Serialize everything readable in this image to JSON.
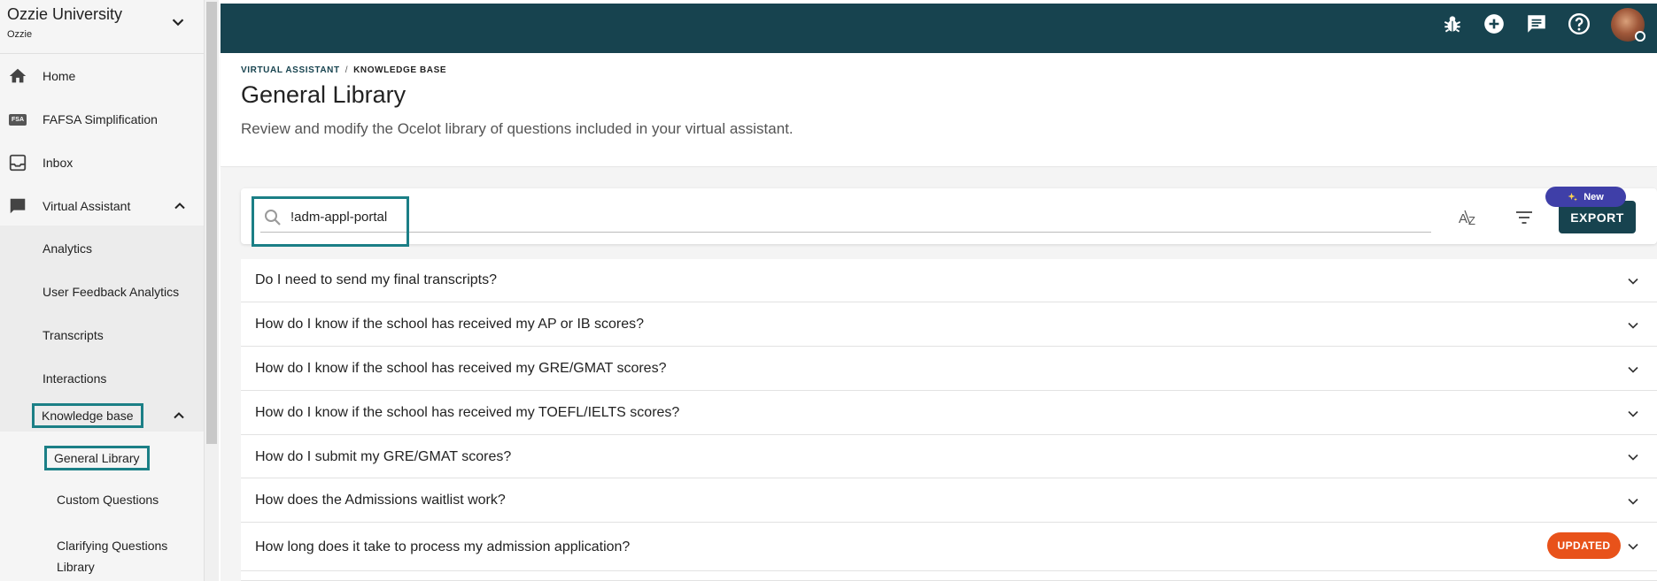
{
  "org": {
    "name": "Ozzie University",
    "sub": "Ozzie"
  },
  "sidebar": {
    "items": [
      {
        "label": "Home",
        "icon": "home-icon"
      },
      {
        "label": "FAFSA Simplification",
        "icon": "fsa-icon",
        "badge": "FSA"
      },
      {
        "label": "Inbox",
        "icon": "inbox-icon"
      },
      {
        "label": "Virtual Assistant",
        "icon": "chat-icon",
        "expanded": true
      }
    ],
    "va_children": [
      {
        "label": "Analytics"
      },
      {
        "label": "User Feedback Analytics"
      },
      {
        "label": "Transcripts"
      },
      {
        "label": "Interactions"
      },
      {
        "label": "Knowledge base",
        "expanded": true
      }
    ],
    "kb_children": [
      {
        "label": "General Library",
        "active": true
      },
      {
        "label": "Custom Questions"
      },
      {
        "label": "Clarifying Questions",
        "label2": "Library"
      }
    ]
  },
  "topbar": {
    "icons": [
      "bug-icon",
      "add-circle-icon",
      "message-icon",
      "help-icon"
    ],
    "color": "#17434f"
  },
  "breadcrumb": {
    "parent": "VIRTUAL ASSISTANT",
    "separator": "/",
    "current": "KNOWLEDGE BASE"
  },
  "page": {
    "title": "General Library",
    "subtitle": "Review and modify the Ocelot library of questions included in your virtual assistant."
  },
  "search": {
    "value": "!adm-appl-portal"
  },
  "toolbar": {
    "export_label": "EXPORT",
    "new_badge": "New"
  },
  "faqs": [
    {
      "question": "Do I need to send my final transcripts?"
    },
    {
      "question": "How do I know if the school has received my AP or IB scores?"
    },
    {
      "question": "How do I know if the school has received my GRE/GMAT scores?"
    },
    {
      "question": "How do I know if the school has received my TOEFL/IELTS scores?"
    },
    {
      "question": "How do I submit my GRE/GMAT scores?"
    },
    {
      "question": "How does the Admissions waitlist work?"
    },
    {
      "question": "How long does it take to process my admission application?",
      "badge": "UPDATED"
    }
  ],
  "colors": {
    "accent": "#17434f",
    "highlight": "#1b7f86",
    "updated": "#e8521a",
    "new": "#3f3fa8"
  }
}
